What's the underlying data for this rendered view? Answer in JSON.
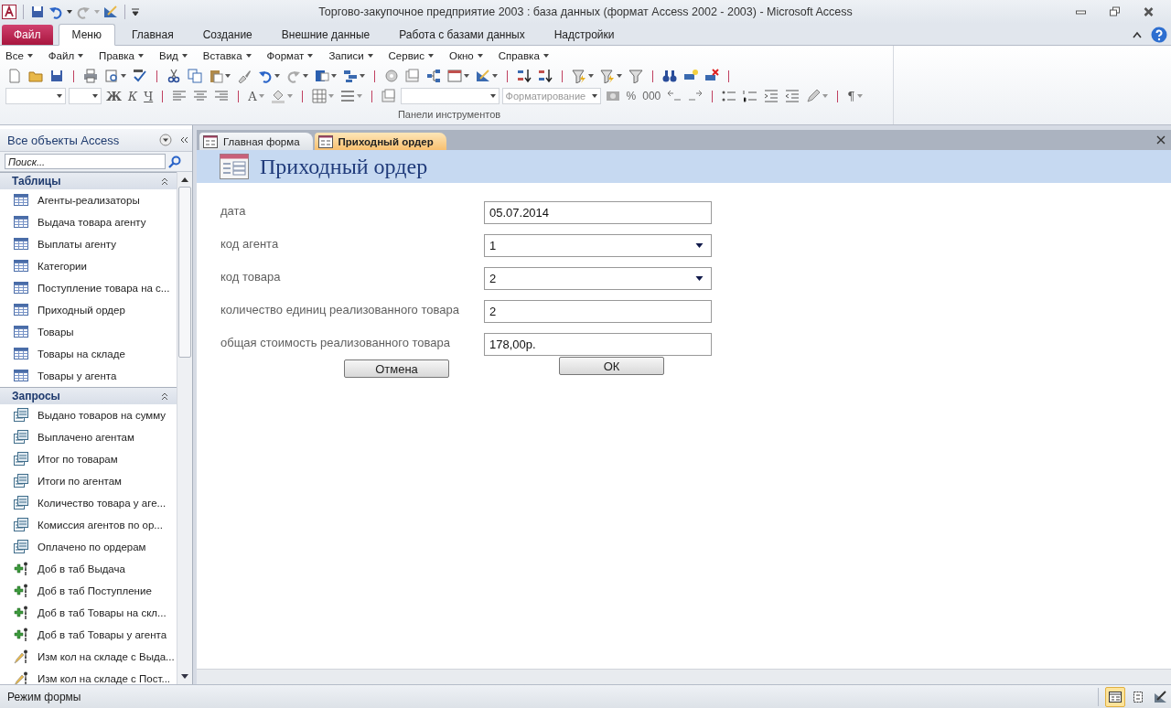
{
  "window": {
    "title": "Торгово-закупочное предприятие 2003 : база данных (формат Access 2002 - 2003)  -  Microsoft Access"
  },
  "ribbon": {
    "tabs": [
      {
        "label": "Файл",
        "kind": "file",
        "selected": false
      },
      {
        "label": "Меню",
        "kind": "tab",
        "selected": true
      },
      {
        "label": "Главная",
        "kind": "tab",
        "selected": false
      },
      {
        "label": "Создание",
        "kind": "tab",
        "selected": false
      },
      {
        "label": "Внешние данные",
        "kind": "tab",
        "selected": false
      },
      {
        "label": "Работа с базами данных",
        "kind": "tab",
        "selected": false
      },
      {
        "label": "Надстройки",
        "kind": "tab",
        "selected": false
      }
    ],
    "menus": [
      "Все",
      "Файл",
      "Правка",
      "Вид",
      "Вставка",
      "Формат",
      "Записи",
      "Сервис",
      "Окно",
      "Справка"
    ],
    "glyphs": [
      "Ж",
      "К",
      "Ч",
      "A",
      "%",
      "000",
      "¶"
    ],
    "format_combo": "Форматирование",
    "group_label": "Панели инструментов"
  },
  "nav": {
    "title": "Все объекты Access",
    "search": {
      "placeholder": "Поиск..."
    },
    "groups": [
      {
        "title": "Таблицы",
        "items": [
          {
            "label": "Агенты-реализаторы",
            "kind": "table"
          },
          {
            "label": "Выдача товара агенту",
            "kind": "table"
          },
          {
            "label": "Выплаты агенту",
            "kind": "table"
          },
          {
            "label": "Категории",
            "kind": "table"
          },
          {
            "label": "Поступление товара на с...",
            "kind": "table"
          },
          {
            "label": "Приходный ордер",
            "kind": "table"
          },
          {
            "label": "Товары",
            "kind": "table"
          },
          {
            "label": "Товары на складе",
            "kind": "table"
          },
          {
            "label": "Товары у агента",
            "kind": "table"
          }
        ]
      },
      {
        "title": "Запросы",
        "items": [
          {
            "label": "Выдано товаров на сумму",
            "kind": "query"
          },
          {
            "label": "Выплачено агентам",
            "kind": "query"
          },
          {
            "label": "Итог по товарам",
            "kind": "query"
          },
          {
            "label": "Итоги по агентам",
            "kind": "query"
          },
          {
            "label": "Количество товара у аге...",
            "kind": "query"
          },
          {
            "label": "Комиссия агентов по ор...",
            "kind": "query"
          },
          {
            "label": "Оплачено по ордерам",
            "kind": "query"
          },
          {
            "label": "Доб в таб Выдача",
            "kind": "append"
          },
          {
            "label": "Доб в таб Поступление",
            "kind": "append"
          },
          {
            "label": "Доб в таб Товары на скл...",
            "kind": "append"
          },
          {
            "label": "Доб в таб Товары у агента",
            "kind": "append"
          },
          {
            "label": "Изм кол на складе с Выда...",
            "kind": "update"
          },
          {
            "label": "Изм кол на складе с Пост...",
            "kind": "update"
          }
        ]
      }
    ]
  },
  "documents": {
    "tabs": [
      {
        "label": "Главная форма",
        "selected": false
      },
      {
        "label": "Приходный ордер",
        "selected": true
      }
    ]
  },
  "form": {
    "title": "Приходный ордер",
    "fields": [
      {
        "label": "дата",
        "value": "05.07.2014",
        "kind": "text"
      },
      {
        "label": "код агента",
        "value": "1",
        "kind": "combo"
      },
      {
        "label": "код товара",
        "value": "2",
        "kind": "combo"
      },
      {
        "label": "количество единиц реализованного товара",
        "value": "2",
        "kind": "text"
      },
      {
        "label": "общая стоимость реализованного товара",
        "value": "178,00р.",
        "kind": "text"
      }
    ],
    "buttons": [
      "Отмена",
      "ОК"
    ]
  },
  "status_bar": {
    "text": "Режим формы",
    "views": [
      {
        "kind": "form",
        "selected": true
      },
      {
        "kind": "layout",
        "selected": false
      },
      {
        "kind": "design",
        "selected": false
      }
    ]
  }
}
